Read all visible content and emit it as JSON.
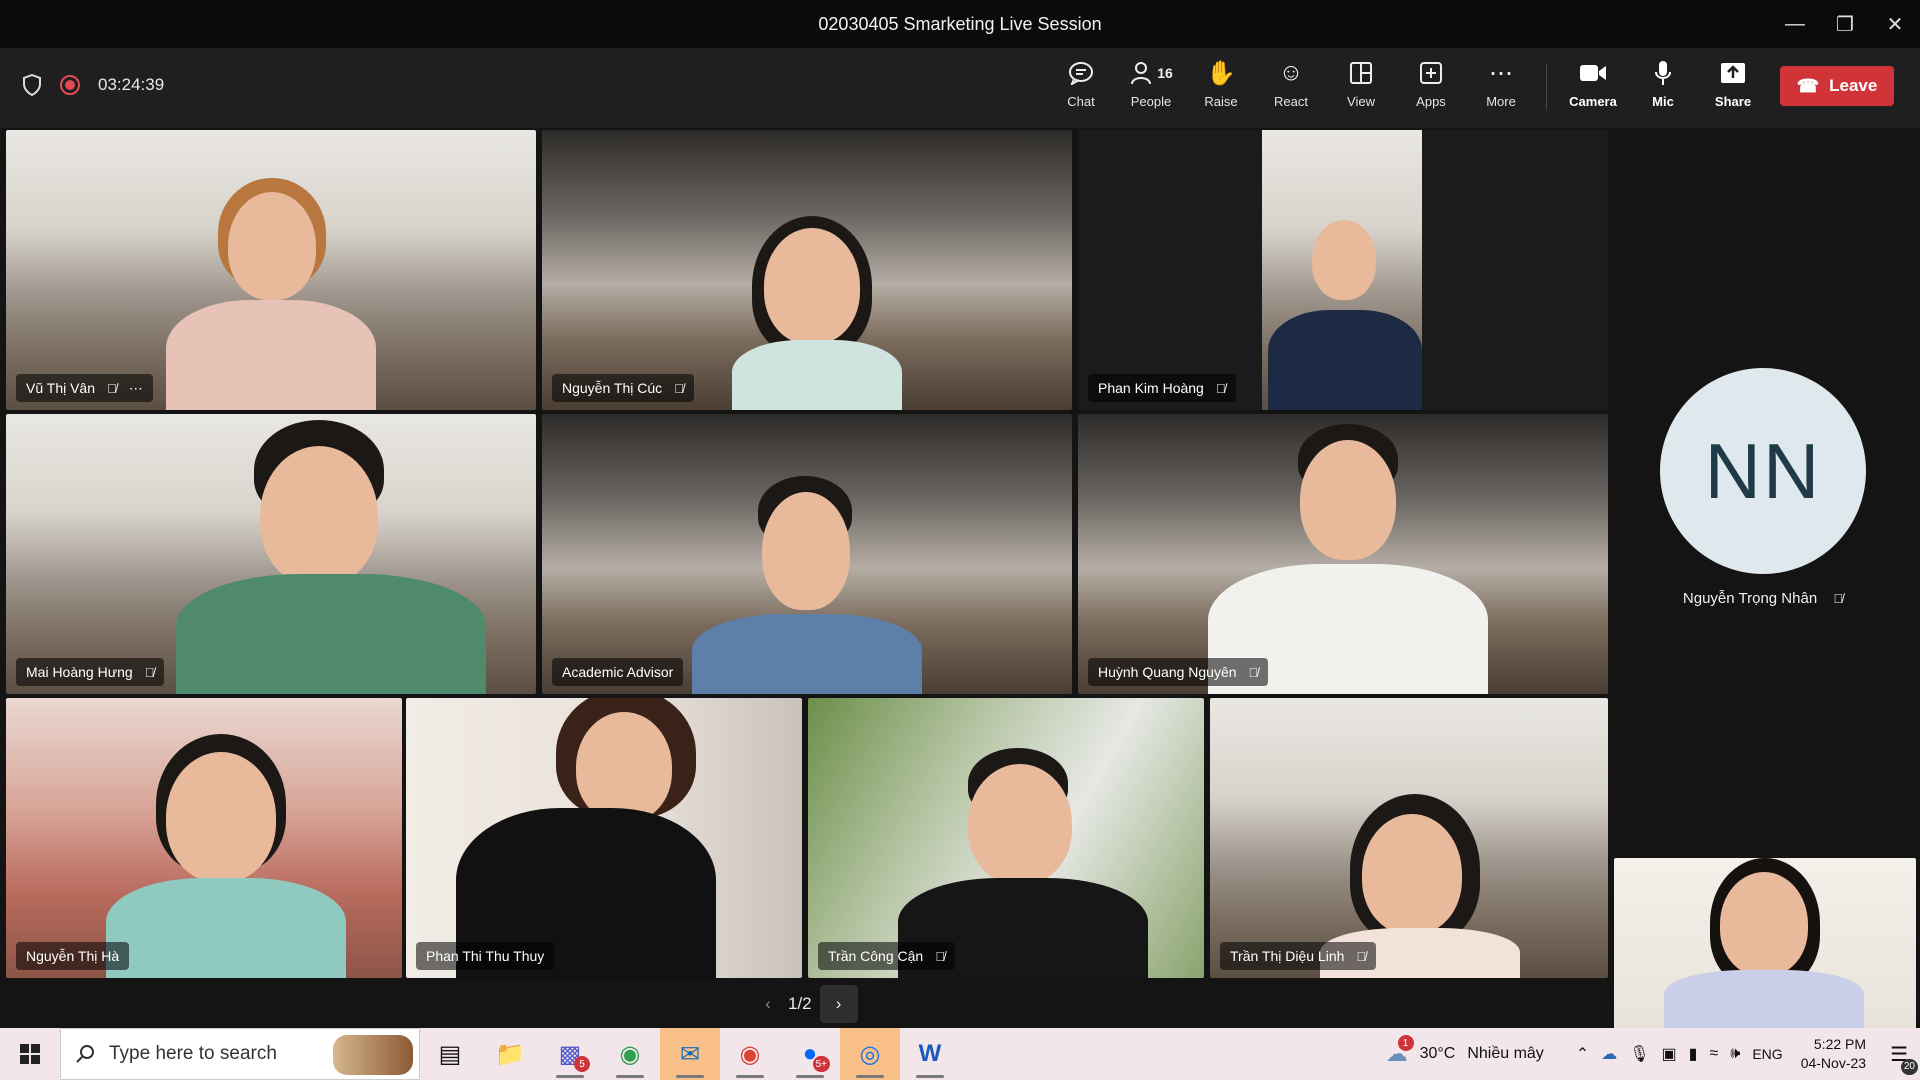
{
  "window": {
    "title": "02030405 Smarketing Live Session"
  },
  "meeting": {
    "elapsed": "03:24:39"
  },
  "toolbar": {
    "chat": "Chat",
    "people": "People",
    "people_count": "16",
    "raise": "Raise",
    "react": "React",
    "view": "View",
    "apps": "Apps",
    "more": "More",
    "camera": "Camera",
    "mic": "Mic",
    "share": "Share",
    "leave": "Leave"
  },
  "participants": [
    {
      "name": "Vũ Thị Vân",
      "muted": true,
      "more_menu": true
    },
    {
      "name": "Nguyễn Thị Cúc",
      "muted": true
    },
    {
      "name": "Phan Kim Hoàng",
      "muted": true
    },
    {
      "name": "Mai Hoàng Hưng",
      "muted": true
    },
    {
      "name": "Academic Advisor",
      "muted": false
    },
    {
      "name": "Huỳnh Quang Nguyên",
      "muted": true
    },
    {
      "name": "Nguyễn Thị Hà",
      "muted": false
    },
    {
      "name": "Phan Thi Thu Thuy",
      "muted": false
    },
    {
      "name": "Trần Công Cận",
      "muted": true
    },
    {
      "name": "Trần Thị Diệu Linh",
      "muted": true
    }
  ],
  "side_participant": {
    "initials": "NN",
    "name": "Nguyễn Trọng Nhân",
    "muted": true
  },
  "pager": {
    "label": "1/2"
  },
  "taskbar": {
    "search_placeholder": "Type here to search",
    "teams_badge": "5",
    "zalo_badge": "5+",
    "weather_temp": "30°C",
    "weather_desc": "Nhiều mây",
    "weather_alert": "1",
    "lang": "ENG",
    "time": "5:22 PM",
    "date": "04-Nov-23",
    "notifications": "20"
  }
}
